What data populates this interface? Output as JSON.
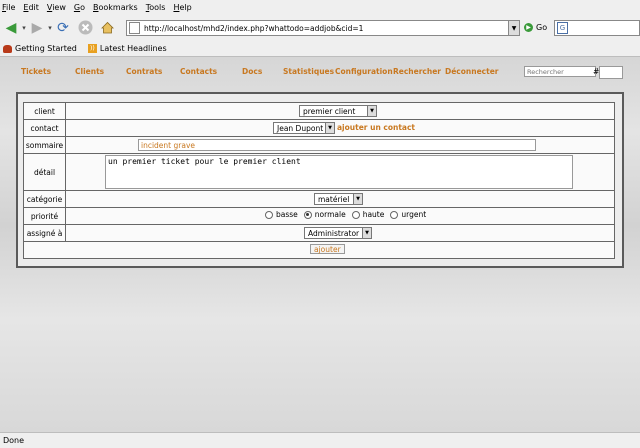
{
  "menubar": {
    "items": [
      "File",
      "Edit",
      "View",
      "Go",
      "Bookmarks",
      "Tools",
      "Help"
    ]
  },
  "toolbar": {
    "url": "http://localhost/mhd2/index.php?whattodo=addjob&cid=1",
    "go_label": "Go"
  },
  "bookmarks": {
    "items": [
      "Getting Started",
      "Latest Headlines"
    ]
  },
  "app_nav": {
    "links": [
      "Tickets",
      "Clients",
      "Contrats",
      "Contacts",
      "Docs",
      "Statistiques",
      "Configuration",
      "Rechercher",
      "Déconnecter"
    ],
    "search_placeholder": "Rechercher",
    "hash": "#"
  },
  "form": {
    "labels": {
      "client": "client",
      "contact": "contact",
      "sommaire": "sommaire",
      "detail": "détail",
      "categorie": "catégorie",
      "priorite": "priorité",
      "assigne": "assigné à"
    },
    "client_value": "premier client",
    "contact_value": "Jean Dupont",
    "add_contact_label": "ajouter un contact",
    "summary_value": "incident grave",
    "detail_value": "un premier ticket pour le premier client",
    "category_value": "matériel",
    "priorities": [
      {
        "label": "basse",
        "checked": false
      },
      {
        "label": "normale",
        "checked": true
      },
      {
        "label": "haute",
        "checked": false
      },
      {
        "label": "urgent",
        "checked": false
      }
    ],
    "assignee_value": "Administrator",
    "submit_label": "ajouter"
  },
  "status": {
    "text": "Done"
  }
}
